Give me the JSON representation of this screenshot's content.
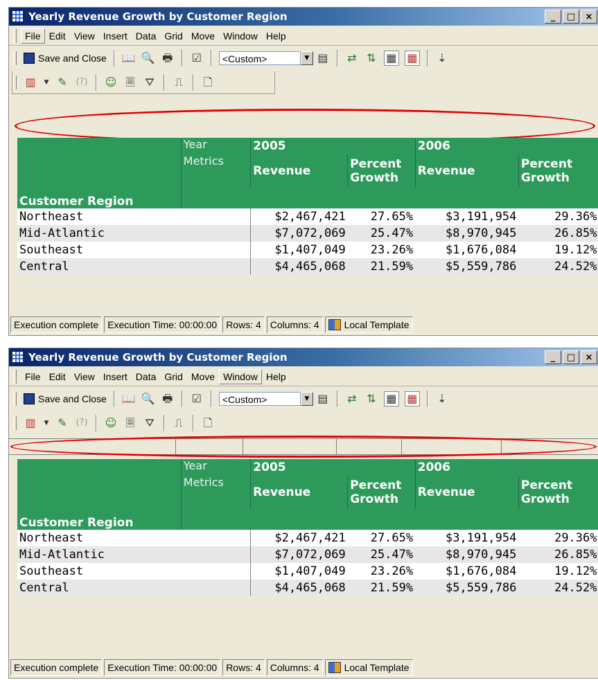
{
  "window": {
    "title": "Yearly Revenue Growth by Customer Region",
    "caption_buttons": [
      "_",
      "□",
      "×"
    ]
  },
  "menubar": {
    "items": [
      "File",
      "Edit",
      "View",
      "Insert",
      "Data",
      "Grid",
      "Move",
      "Window",
      "Help"
    ]
  },
  "toolbar": {
    "save_close_label": "Save and Close",
    "template_combo_value": "<Custom>",
    "icons": [
      "floppy-disk-icon",
      "open-book-icon",
      "print-preview-icon",
      "printer-icon",
      "properties-icon",
      "combo-arrow-icon",
      "table-report-icon",
      "pivot-icon",
      "swap-icon",
      "grid-lines-icon",
      "grid-outline-icon",
      "sort-ascending-icon"
    ],
    "row2_icons": [
      "chart-icon",
      "dropdown-arrow-icon",
      "wizard-icon",
      "help-icon",
      "users-icon",
      "page-icon",
      "filter-icon",
      "book-icon",
      "page-setup-icon"
    ]
  },
  "grid": {
    "year_label": "Year",
    "metrics_label": "Metrics",
    "row_header": "Customer Region",
    "years": [
      "2005",
      "2006"
    ],
    "metric_revenue": "Revenue",
    "metric_growth_line1": "Percent",
    "metric_growth_line2": "Growth",
    "rows": [
      {
        "region": "Northeast",
        "rev2005": "$2,467,421",
        "pct2005": "27.65%",
        "rev2006": "$3,191,954",
        "pct2006": "29.36%"
      },
      {
        "region": "Mid-Atlantic",
        "rev2005": "$7,072,069",
        "pct2005": "25.47%",
        "rev2006": "$8,970,945",
        "pct2006": "26.85%"
      },
      {
        "region": "Southeast",
        "rev2005": "$1,407,049",
        "pct2005": "23.26%",
        "rev2006": "$1,676,084",
        "pct2006": "19.12%"
      },
      {
        "region": "Central",
        "rev2005": "$4,465,068",
        "pct2005": "21.59%",
        "rev2006": "$5,559,786",
        "pct2006": "24.52%"
      }
    ]
  },
  "statusbar": {
    "status": "Execution complete",
    "exec_time": "Execution Time: 00:00:00",
    "rows": "Rows: 4",
    "columns": "Columns: 4",
    "template": "Local Template"
  },
  "colors": {
    "header_green": "#2d9a5c",
    "annotation_red": "#e20000",
    "title_gradient_start": "#0a246a"
  }
}
